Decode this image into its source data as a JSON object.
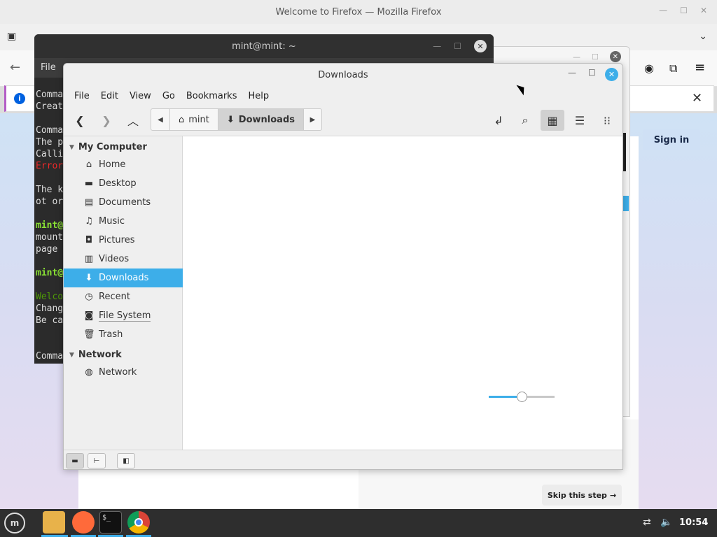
{
  "firefox": {
    "window_title": "Welcome to Firefox — Mozilla Firefox",
    "signin_label": "Sign in",
    "skip_label": "Skip this step",
    "notice_info": "i"
  },
  "terminal": {
    "title": "mint@mint: ~",
    "menu_file": "File",
    "lines": [
      {
        "text": "Comma",
        "style": ""
      },
      {
        "text": "Creat",
        "style": ""
      },
      {
        "text": "",
        "style": ""
      },
      {
        "text": "Comma",
        "style": ""
      },
      {
        "text": "The p",
        "style": ""
      },
      {
        "text": "Calli",
        "style": ""
      },
      {
        "text": "Error",
        "style": "red"
      },
      {
        "text": "",
        "style": ""
      },
      {
        "text": "The k",
        "style": ""
      },
      {
        "text": "ot or",
        "style": ""
      },
      {
        "text": "",
        "style": ""
      },
      {
        "text": "mint@",
        "style": "green"
      },
      {
        "text": "mount",
        "style": ""
      },
      {
        "text": "page ",
        "style": ""
      },
      {
        "text": "",
        "style": ""
      },
      {
        "text": "mint@",
        "style": "green"
      },
      {
        "text": "",
        "style": ""
      },
      {
        "text": "Welco",
        "style": "dgreen"
      },
      {
        "text": "Chang",
        "style": ""
      },
      {
        "text": "Be ca",
        "style": ""
      },
      {
        "text": "",
        "style": ""
      },
      {
        "text": "",
        "style": ""
      },
      {
        "text": "Comma",
        "style": ""
      }
    ]
  },
  "nemo": {
    "title": "Downloads",
    "menu": [
      "File",
      "Edit",
      "View",
      "Go",
      "Bookmarks",
      "Help"
    ],
    "breadcrumbs": [
      {
        "label": "mint",
        "icon": "home-icon",
        "active": false
      },
      {
        "label": "Downloads",
        "icon": "download-icon",
        "active": true
      }
    ],
    "sidebar": {
      "my_computer_label": "My Computer",
      "network_label": "Network",
      "items": [
        {
          "label": "Home",
          "icon": "home-icon"
        },
        {
          "label": "Desktop",
          "icon": "desktop-icon"
        },
        {
          "label": "Documents",
          "icon": "document-icon"
        },
        {
          "label": "Music",
          "icon": "music-icon"
        },
        {
          "label": "Pictures",
          "icon": "camera-icon"
        },
        {
          "label": "Videos",
          "icon": "film-icon"
        },
        {
          "label": "Downloads",
          "icon": "download-icon",
          "selected": true
        },
        {
          "label": "Recent",
          "icon": "clock-icon"
        },
        {
          "label": "File System",
          "icon": "drive-icon"
        },
        {
          "label": "Trash",
          "icon": "trash-icon"
        }
      ],
      "network_items": [
        {
          "label": "Network",
          "icon": "globe-icon"
        }
      ]
    },
    "zoom_level": 0.5
  },
  "taskbar": {
    "clock": "10:54",
    "menu_glyph": "m"
  }
}
